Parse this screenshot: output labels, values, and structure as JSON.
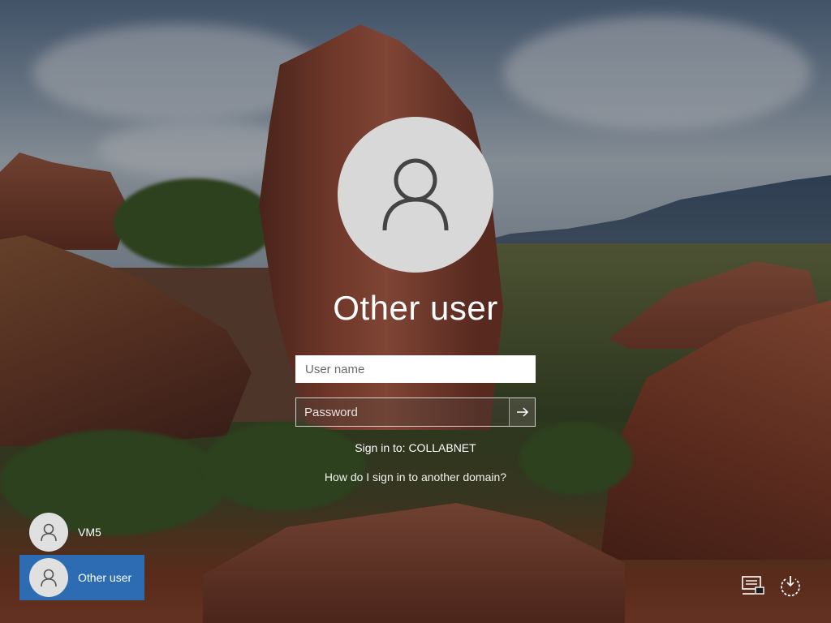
{
  "login": {
    "title": "Other user",
    "username_placeholder": "User name",
    "password_placeholder": "Password",
    "sign_in_to": "Sign in to: COLLABNET",
    "domain_help_link": "How do I sign in to another domain?"
  },
  "users": [
    {
      "name": "VM5",
      "selected": false
    },
    {
      "name": "Other user",
      "selected": true
    }
  ],
  "icons": {
    "submit": "arrow-right-icon",
    "network": "network-icon",
    "power": "power-icon",
    "avatar": "user-icon"
  },
  "colors": {
    "selected_user_bg": "#2d6cb3",
    "avatar_bg": "#d8d8d8"
  }
}
